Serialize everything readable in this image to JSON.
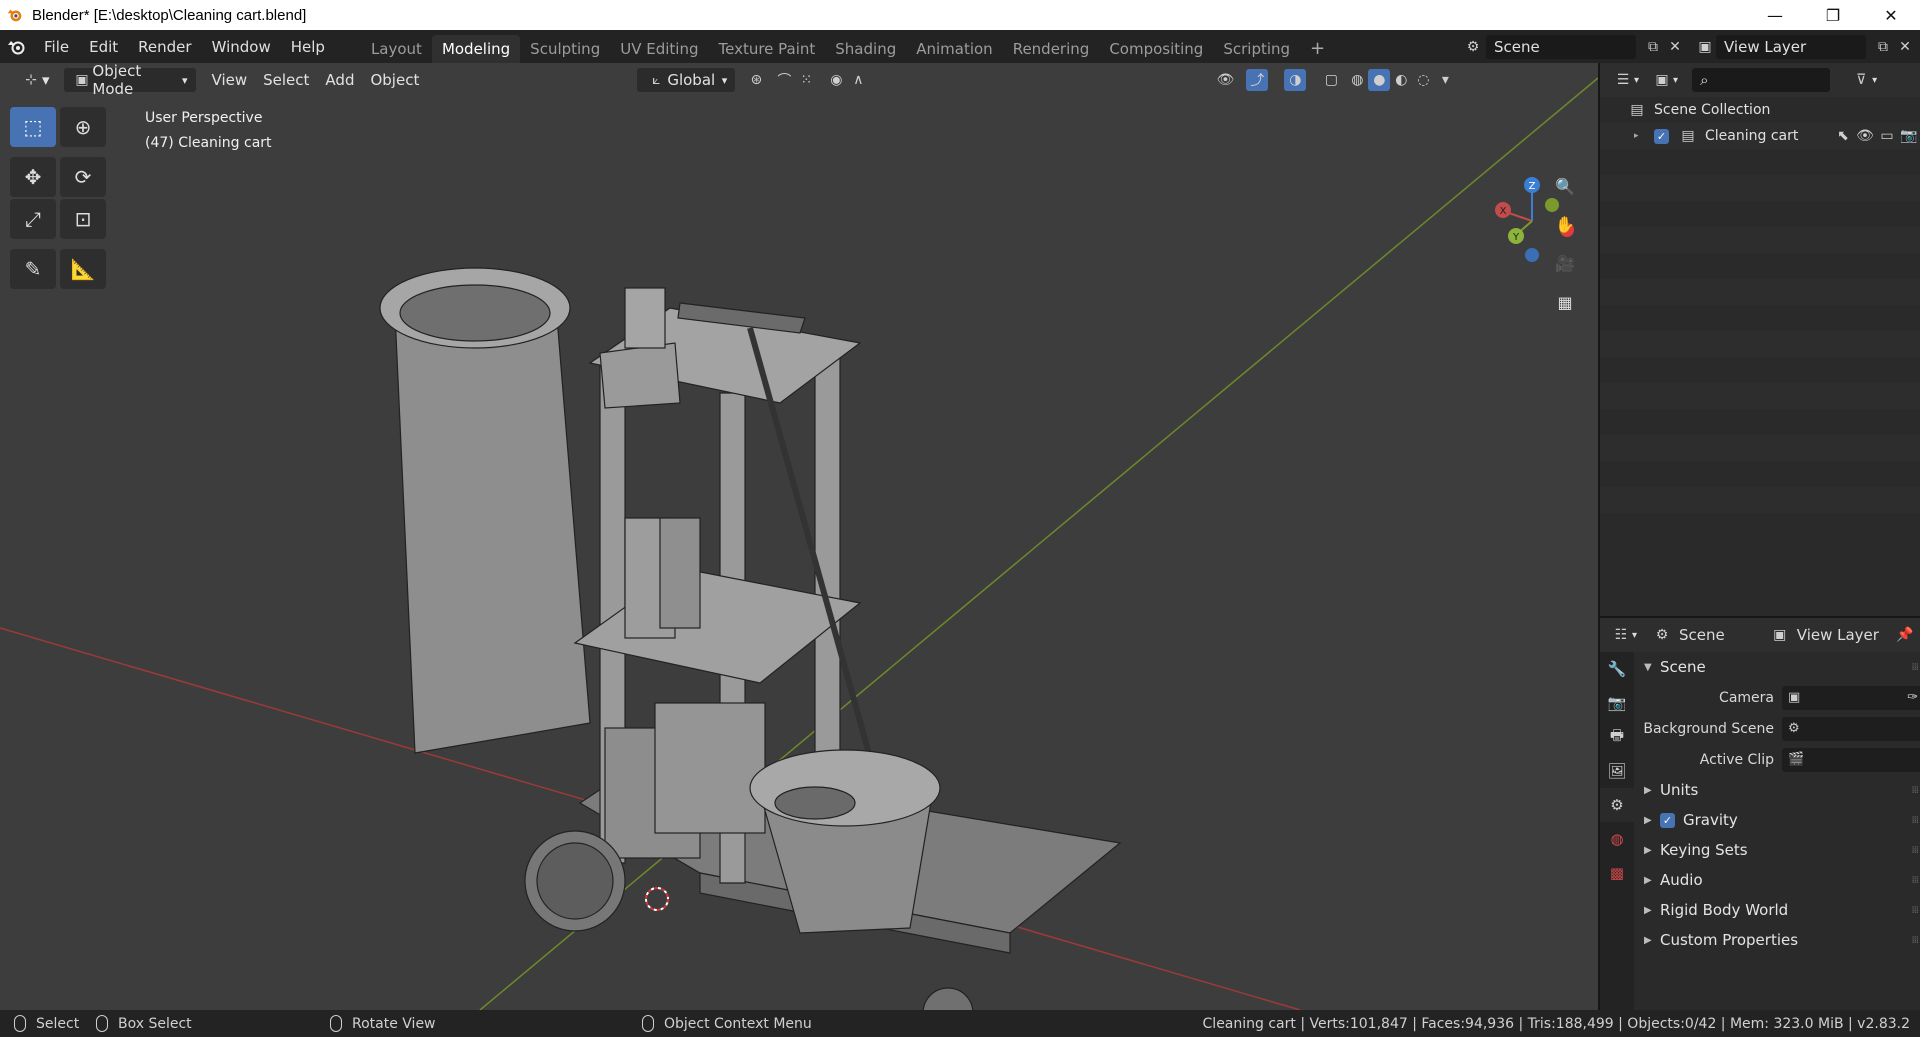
{
  "window": {
    "title": "Blender* [E:\\desktop\\Cleaning cart.blend]",
    "minimize": "—",
    "maximize": "❐",
    "close": "✕"
  },
  "menu": [
    "File",
    "Edit",
    "Render",
    "Window",
    "Help"
  ],
  "workspaces": [
    {
      "label": "Layout",
      "active": false
    },
    {
      "label": "Modeling",
      "active": true
    },
    {
      "label": "Sculpting",
      "active": false
    },
    {
      "label": "UV Editing",
      "active": false
    },
    {
      "label": "Texture Paint",
      "active": false
    },
    {
      "label": "Shading",
      "active": false
    },
    {
      "label": "Animation",
      "active": false
    },
    {
      "label": "Rendering",
      "active": false
    },
    {
      "label": "Compositing",
      "active": false
    },
    {
      "label": "Scripting",
      "active": false
    }
  ],
  "add_workspace": "+",
  "scene_selector": "Scene",
  "view_layer_selector": "View Layer",
  "viewport_header": {
    "mode": "Object Mode",
    "menus": [
      "View",
      "Select",
      "Add",
      "Object"
    ],
    "transform_orientation": "Global"
  },
  "viewport_info": {
    "view": "User Perspective",
    "object": "(47) Cleaning cart"
  },
  "gizmo": {
    "x": "X",
    "y": "Y",
    "z": "Z"
  },
  "outliner": {
    "items": [
      {
        "label": "Scene Collection"
      },
      {
        "label": "Cleaning cart"
      }
    ]
  },
  "properties": {
    "header_scene": "Scene",
    "header_view_layer": "View Layer",
    "section": "Scene",
    "rows": [
      {
        "label": "Camera"
      },
      {
        "label": "Background Scene"
      },
      {
        "label": "Active Clip"
      }
    ],
    "subsections": [
      {
        "label": "Units",
        "checkbox": false
      },
      {
        "label": "Gravity",
        "checkbox": true
      },
      {
        "label": "Keying Sets",
        "checkbox": false
      },
      {
        "label": "Audio",
        "checkbox": false
      },
      {
        "label": "Rigid Body World",
        "checkbox": false
      },
      {
        "label": "Custom Properties",
        "checkbox": false
      }
    ]
  },
  "statusbar": {
    "select": "Select",
    "box_select": "Box Select",
    "rotate_view": "Rotate View",
    "context_menu": "Object Context Menu",
    "stats": "Cleaning cart | Verts:101,847 | Faces:94,936 | Tris:188,499 | Objects:0/42 | Mem: 323.0 MiB | v2.83.2"
  },
  "colors": {
    "accent": "#4772b3",
    "viewport_bg": "#3d3d3d",
    "x_axis": "#c24b4b",
    "y_axis": "#7a9a2e"
  }
}
